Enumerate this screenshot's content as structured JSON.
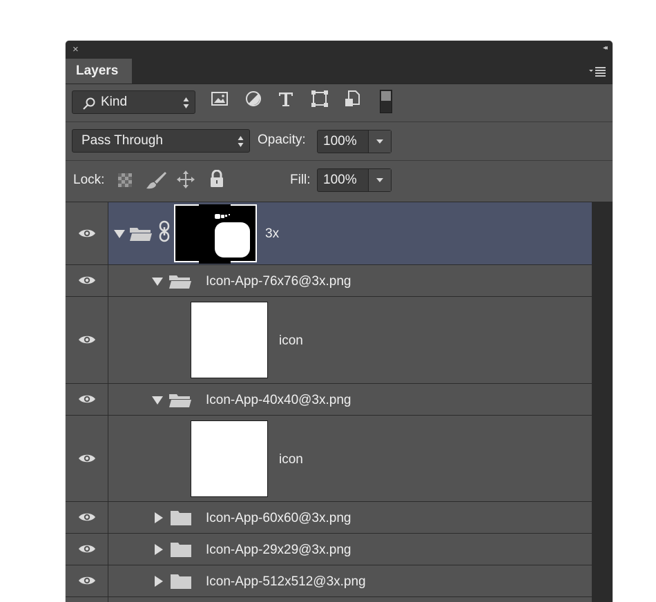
{
  "window": {
    "close_glyph": "×",
    "collapse_glyph": "◂◂",
    "menu_icon": "panel-menu-icon"
  },
  "tab": {
    "label": "Layers"
  },
  "filter": {
    "kind_label": "Kind",
    "search_icon": "search-icon",
    "icons": [
      "pixel-filter-icon",
      "adjustment-filter-icon",
      "type-filter-icon",
      "shape-filter-icon",
      "smart-object-filter-icon",
      "filter-toggle-icon"
    ]
  },
  "blend": {
    "mode": "Pass Through",
    "opacity_label": "Opacity:",
    "opacity_value": "100%"
  },
  "lock": {
    "label": "Lock:",
    "fill_label": "Fill:",
    "fill_value": "100%",
    "icons": [
      "lock-transparent-icon",
      "lock-image-icon",
      "lock-position-icon",
      "lock-all-icon"
    ]
  },
  "layers": [
    {
      "name": "3x",
      "type": "group",
      "expanded": true,
      "selected": true,
      "has_mask": true,
      "visible": true
    },
    {
      "name": "Icon-App-76x76@3x.png",
      "type": "group",
      "expanded": true,
      "visible": true
    },
    {
      "name": "icon",
      "type": "layer",
      "visible": true
    },
    {
      "name": "Icon-App-40x40@3x.png",
      "type": "group",
      "expanded": true,
      "visible": true
    },
    {
      "name": "icon",
      "type": "layer",
      "visible": true
    },
    {
      "name": "Icon-App-60x60@3x.png",
      "type": "group",
      "expanded": false,
      "visible": true
    },
    {
      "name": "Icon-App-29x29@3x.png",
      "type": "group",
      "expanded": false,
      "visible": true
    },
    {
      "name": "Icon-App-512x512@3x.png",
      "type": "group",
      "expanded": false,
      "visible": true
    }
  ],
  "colors": {
    "panel": "#535353",
    "dark": "#2c2c2c",
    "selected": "#4c5369",
    "text": "#f0f0f0"
  }
}
